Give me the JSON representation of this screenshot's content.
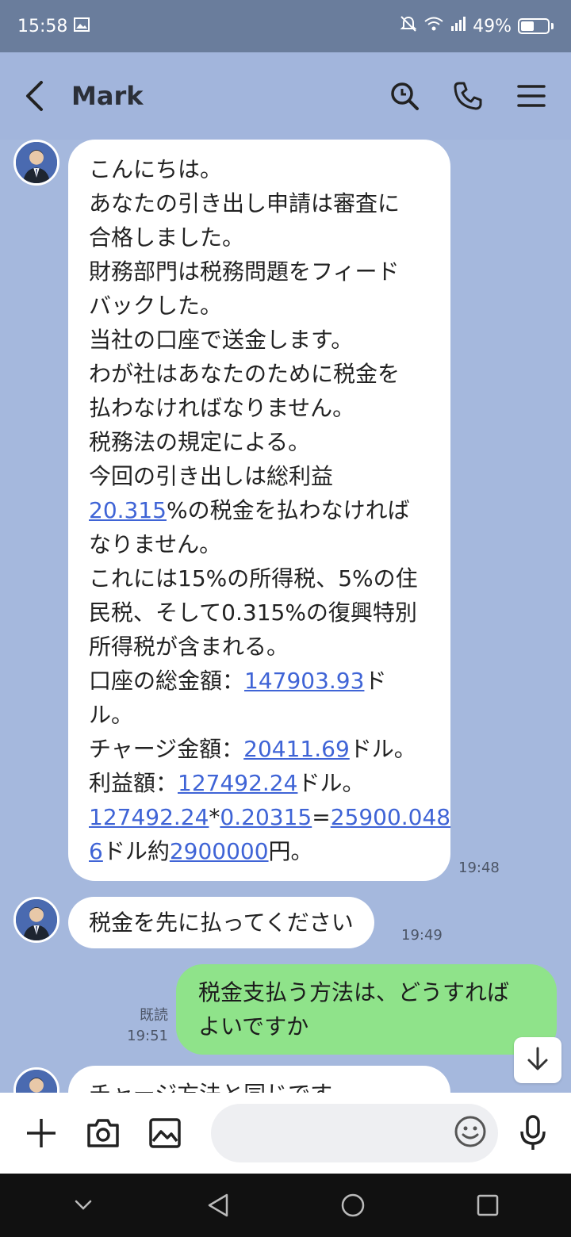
{
  "status": {
    "time": "15:58",
    "battery": "49%"
  },
  "header": {
    "title": "Mark"
  },
  "messages": {
    "m1": {
      "lines": [
        "こんにちは。",
        "あなたの引き出し申請は審査に",
        "合格しました。",
        "財務部門は税務問題をフィード",
        "バックした。",
        "当社の口座で送金します。",
        "わが社はあなたのために税金を",
        "払わなければなりません。",
        "税務法の規定による。",
        "今回の引き出しは総利益"
      ],
      "rate": "20.315",
      "rate_suffix": "%の税金を払わなければ",
      "lines2": [
        "なりません。",
        "これには15%の所得税、5%の住",
        "民税、そして0.315%の復興特別",
        "所得税が含まれる。"
      ],
      "total_prefix": "口座の総金額：",
      "total_value": "147903.93",
      "total_suffix": "ド",
      "total_suffix2": "ル。",
      "charge_prefix": "チャージ金額：",
      "charge_value": "20411.69",
      "charge_suffix": "ドル。",
      "profit_prefix": "利益額：",
      "profit_value": "127492.24",
      "profit_suffix": "ドル。",
      "calc_a": "127492.24",
      "calc_star": "*",
      "calc_b": "0.20315",
      "calc_eq": "=",
      "calc_c": "25900.048",
      "calc_c2": "6",
      "calc_mid": "ドル約",
      "calc_yen": "2900000",
      "calc_end": "円。",
      "time": "19:48"
    },
    "m2": {
      "text": "税金を先に払ってください",
      "time": "19:49"
    },
    "m3": {
      "line1": "税金支払う方法は、どうすれば",
      "line2": "よいですか",
      "read_label": "既読",
      "time": "19:51"
    },
    "m4": {
      "partial": "チャージ方法と同じです。"
    }
  },
  "icons": {
    "back": "back-arrow-icon",
    "search": "search-icon",
    "call": "phone-icon",
    "menu": "menu-icon",
    "add": "plus-icon",
    "camera": "camera-icon",
    "image": "image-icon",
    "emoji": "emoji-icon",
    "mic": "mic-icon",
    "scroll": "arrow-down-icon"
  },
  "colors": {
    "chat_bg": "#a5b8dd",
    "incoming": "#ffffff",
    "outgoing": "#8fe38a",
    "link": "#3f64d6"
  }
}
